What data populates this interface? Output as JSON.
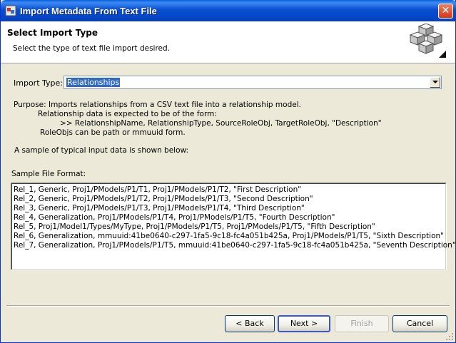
{
  "window": {
    "title": "Import Metadata From Text File",
    "close_glyph": "✕"
  },
  "banner": {
    "title": "Select Import Type",
    "description": "Select the type of text file import desired.",
    "icon": "cubes-icon"
  },
  "import_type": {
    "label": "Import Type:",
    "selected": "Relationships"
  },
  "purpose": {
    "line1": "Purpose: Imports relationships from a CSV text file into a relationship model.",
    "line2": "Relationship data is expected to be of the form:",
    "line3": ">> RelationshipName, RelationshipType, SourceRoleObj, TargetRoleObj, \"Description\"",
    "line4": "RoleObjs can be path or mmuuid form."
  },
  "sample": {
    "intro": "A sample of typical input data is shown below:",
    "label": "Sample File Format:",
    "lines": [
      "Rel_1, Generic, Proj1/PModels/P1/T1, Proj1/PModels/P1/T2, \"First Description\"",
      "Rel_2, Generic, Proj1/PModels/P1/T2, Proj1/PModels/P1/T3, \"Second Description\"",
      "Rel_3, Generic, Proj1/PModels/P1/T3, Proj1/PModels/P1/T4, \"Third Description\"",
      "Rel_4, Generalization, Proj1/PModels/P1/T4, Proj1/PModels/P1/T5, \"Fourth Description\"",
      "Rel_5, Proj1/Model1/Types/MyType, Proj1/PModels/P1/T5, Proj1/PModels/P1/T5, \"Fifth Description\"",
      "Rel_6, Generalization, mmuuid:41be0640-c297-1fa5-9c18-fc4a051b425a, Proj1/PModels/P1/T5, \"Sixth Description\"",
      "Rel_7, Generalization, Proj1/PModels/P1/T5, mmuuid:41be0640-c297-1fa5-9c18-fc4a051b425a, \"Seventh Description\""
    ]
  },
  "buttons": {
    "back": "< Back",
    "next": "Next >",
    "finish": "Finish",
    "cancel": "Cancel"
  },
  "colors": {
    "titlebar": "#0247c9",
    "selection": "#316ac5",
    "dialog_bg": "#ece9d8"
  }
}
